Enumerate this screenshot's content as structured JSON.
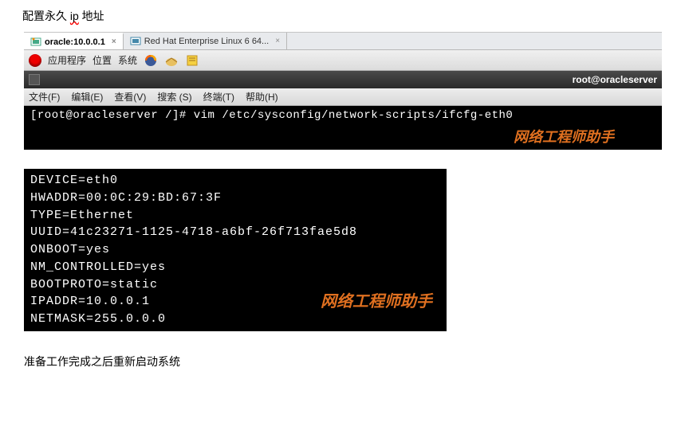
{
  "doc": {
    "title_prefix": "配置永久 ",
    "title_ip": "ip",
    "title_suffix": " 地址",
    "footer": "准备工作完成之后重新启动系统"
  },
  "tabs": {
    "active": "oracle:10.0.0.1",
    "active_close": "×",
    "inactive": "Red Hat Enterprise Linux 6 64...",
    "inactive_close": "×"
  },
  "panel": {
    "apps": "应用程序",
    "places": "位置",
    "system": "系统"
  },
  "term_header": {
    "title": "root@oracleserver"
  },
  "term_menu": {
    "file": "文件(F)",
    "edit": "编辑(E)",
    "view": "查看(V)",
    "search": "搜索 (S)",
    "terminal": "终端(T)",
    "help": "帮助(H)"
  },
  "terminal": {
    "line1": "[root@oracleserver /]# vim /etc/sysconfig/network-scripts/ifcfg-eth0",
    "watermark": "网络工程师助手"
  },
  "config": {
    "l1": "DEVICE=eth0",
    "l2": "HWADDR=00:0C:29:BD:67:3F",
    "l3": "TYPE=Ethernet",
    "l4": "UUID=41c23271-1125-4718-a6bf-26f713fae5d8",
    "l5": "ONBOOT=yes",
    "l6": "NM_CONTROLLED=yes",
    "l7": "BOOTPROTO=static",
    "l8": "IPADDR=10.0.0.1",
    "l9": "NETMASK=255.0.0.0",
    "watermark": "网络工程师助手"
  }
}
